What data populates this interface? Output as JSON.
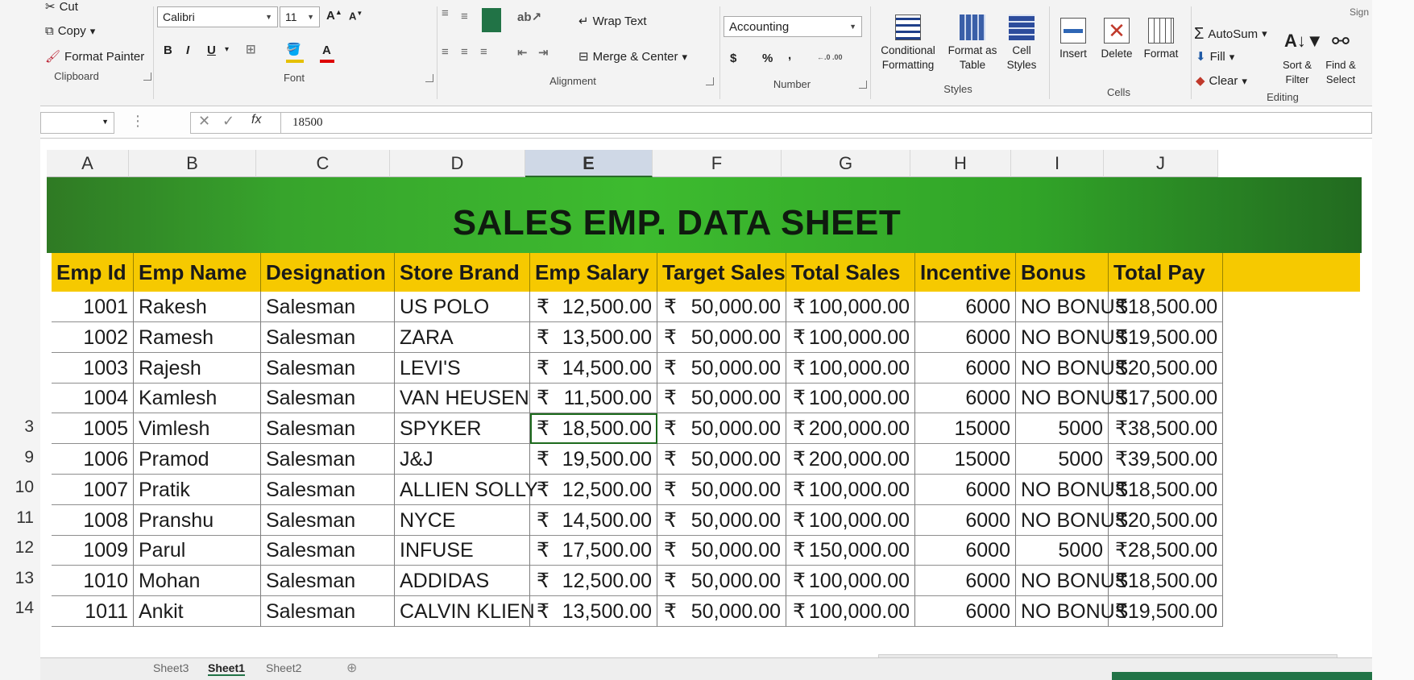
{
  "ribbon": {
    "clipboard": {
      "cut": "Cut",
      "copy": "Copy",
      "format_painter": "Format Painter",
      "label": "Clipboard"
    },
    "font": {
      "font_name": "Calibri",
      "font_size": "11",
      "bold": "B",
      "italic": "I",
      "underline": "U",
      "font_color": "A",
      "label": "Font"
    },
    "alignment": {
      "wrap_text": "Wrap Text",
      "merge_center": "Merge & Center",
      "label": "Alignment"
    },
    "number": {
      "format": "Accounting",
      "currency": "$",
      "percent": "%",
      "comma": ",",
      "inc_decimal": "←.0 .00",
      "dec_decimal": ".00 →.0",
      "label": "Number"
    },
    "styles": {
      "conditional_formatting": "Conditional Formatting",
      "format_as_table": "Format as Table",
      "cell_styles": "Cell Styles",
      "label": "Styles"
    },
    "cells": {
      "insert": "Insert",
      "delete": "Delete",
      "format": "Format",
      "label": "Cells"
    },
    "editing": {
      "autosum": "AutoSum",
      "fill": "Fill",
      "clear": "Clear",
      "sort_filter": "Sort & Filter",
      "find_select": "Find & Select",
      "label": "Editing"
    },
    "signin": "Sign"
  },
  "formula_bar": {
    "value": "18500",
    "fx": "fx"
  },
  "columns": [
    "A",
    "B",
    "C",
    "D",
    "E",
    "F",
    "G",
    "H",
    "I",
    "J"
  ],
  "selected_column": "E",
  "row_numbers": [
    "",
    "",
    "",
    "",
    "",
    "3",
    "9",
    "10",
    "11",
    "12",
    "13",
    "14"
  ],
  "sheet": {
    "title": "SALES EMP. DATA SHEET",
    "headers": [
      "Emp Id",
      "Emp Name",
      "Designation",
      "Store Brand",
      "Emp Salary",
      "Target Sales",
      "Total Sales",
      "Incentive",
      "Bonus",
      "Total Pay"
    ],
    "rows": [
      [
        "1001",
        "Rakesh",
        "Salesman",
        "US POLO",
        "12,500.00",
        "50,000.00",
        "100,000.00",
        "6000",
        "NO BONUS",
        "18,500.00"
      ],
      [
        "1002",
        "Ramesh",
        "Salesman",
        "ZARA",
        "13,500.00",
        "50,000.00",
        "100,000.00",
        "6000",
        "NO BONUS",
        "19,500.00"
      ],
      [
        "1003",
        "Rajesh",
        "Salesman",
        "LEVI'S",
        "14,500.00",
        "50,000.00",
        "100,000.00",
        "6000",
        "NO BONUS",
        "20,500.00"
      ],
      [
        "1004",
        "Kamlesh",
        "Salesman",
        "VAN HEUSEN",
        "11,500.00",
        "50,000.00",
        "100,000.00",
        "6000",
        "NO BONUS",
        "17,500.00"
      ],
      [
        "1005",
        "Vimlesh",
        "Salesman",
        "SPYKER",
        "18,500.00",
        "50,000.00",
        "200,000.00",
        "15000",
        "5000",
        "38,500.00"
      ],
      [
        "1006",
        "Pramod",
        "Salesman",
        "J&J",
        "19,500.00",
        "50,000.00",
        "200,000.00",
        "15000",
        "5000",
        "39,500.00"
      ],
      [
        "1007",
        "Pratik",
        "Salesman",
        "ALLIEN SOLLY",
        "12,500.00",
        "50,000.00",
        "100,000.00",
        "6000",
        "NO BONUS",
        "18,500.00"
      ],
      [
        "1008",
        "Pranshu",
        "Salesman",
        "NYCE",
        "14,500.00",
        "50,000.00",
        "100,000.00",
        "6000",
        "NO BONUS",
        "20,500.00"
      ],
      [
        "1009",
        "Parul",
        "Salesman",
        "INFUSE",
        "17,500.00",
        "50,000.00",
        "150,000.00",
        "6000",
        "5000",
        "28,500.00"
      ],
      [
        "1010",
        "Mohan",
        "Salesman",
        "ADDIDAS",
        "12,500.00",
        "50,000.00",
        "100,000.00",
        "6000",
        "NO BONUS",
        "18,500.00"
      ],
      [
        "1011",
        "Ankit",
        "Salesman",
        "CALVIN KLIEN",
        "13,500.00",
        "50,000.00",
        "100,000.00",
        "6000",
        "NO BONUS",
        "19,500.00"
      ]
    ],
    "currency_symbol": "₹"
  },
  "tabs": [
    "Sheet3",
    "Sheet1",
    "Sheet2"
  ],
  "active_tab": "Sheet1",
  "colors": {
    "title_band": "#37a42c",
    "header_row": "#f6c900",
    "excel_green": "#217346"
  }
}
